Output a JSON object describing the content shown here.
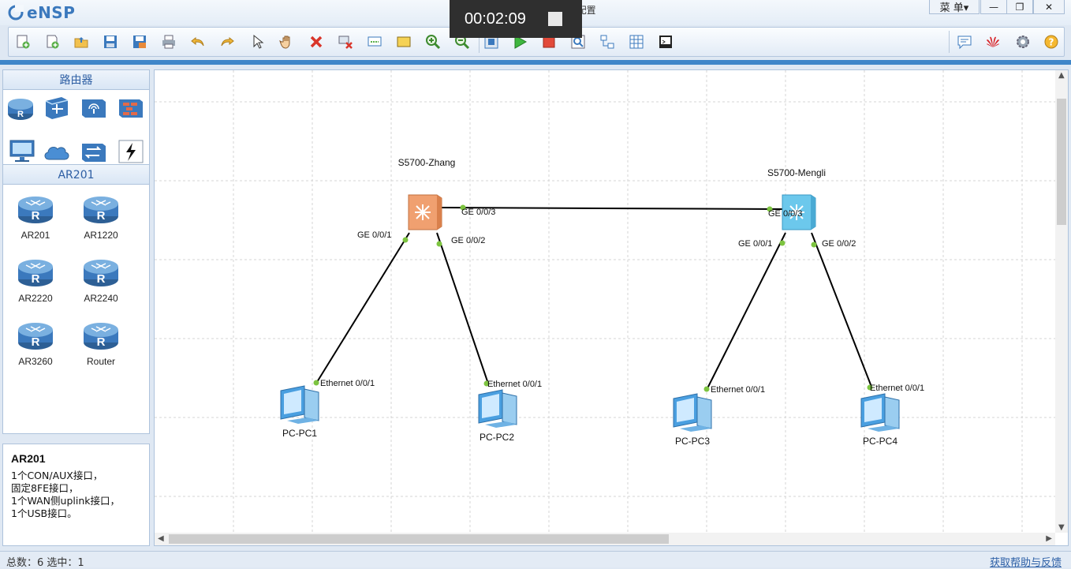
{
  "app": {
    "name": "eNSP",
    "window_title": "实验2交换机基本配置"
  },
  "window_controls": {
    "menu_label": "菜 单▾",
    "minimize": "—",
    "restore": "❐",
    "close": "✕"
  },
  "recording": {
    "time": "00:02:09"
  },
  "toolbar": {
    "left_icons": [
      "new-topology-icon",
      "new-template-icon",
      "open-icon",
      "save-icon",
      "save-as-icon",
      "print-icon",
      "undo-icon",
      "redo-icon",
      "select-icon",
      "pan-hand-icon",
      "delete-icon",
      "delete-link-icon",
      "text-icon",
      "rectangle-icon",
      "zoom-in-icon",
      "zoom-out-icon",
      "fit-icon",
      "start-device-icon",
      "stop-device-icon",
      "capture-icon",
      "topology-icon",
      "grid-icon",
      "console-icon"
    ],
    "right_icons": [
      "chat-icon",
      "huawei-icon",
      "settings-icon",
      "help-icon"
    ]
  },
  "left_panel": {
    "category_title": "路由器",
    "categories": [
      "router-category-icon",
      "switch-category-icon",
      "wlan-category-icon",
      "firewall-category-icon",
      "terminal-category-icon",
      "cloud-category-icon",
      "other-device-icon",
      "link-category-icon"
    ],
    "subcategory_title": "AR201",
    "devices": [
      {
        "label": "AR201"
      },
      {
        "label": "AR1220"
      },
      {
        "label": "AR2220"
      },
      {
        "label": "AR2240"
      },
      {
        "label": "AR3260"
      },
      {
        "label": "Router"
      }
    ],
    "info": {
      "title": "AR201",
      "lines": [
        "1个CON/AUX接口，",
        "固定8FE接口，",
        "1个WAN侧uplink接口，",
        "1个USB接口。"
      ]
    }
  },
  "topology": {
    "switches": [
      {
        "name": "S5700-Zhang",
        "color": "#f0a070"
      },
      {
        "name": "S5700-Mengli",
        "color": "#6cc8ec"
      }
    ],
    "pcs": [
      {
        "name": "PC-PC1"
      },
      {
        "name": "PC-PC2"
      },
      {
        "name": "PC-PC3"
      },
      {
        "name": "PC-PC4"
      }
    ],
    "port_labels": {
      "zhang_ge001": "GE 0/0/1",
      "zhang_ge002": "GE 0/0/2",
      "zhang_ge003": "GE 0/0/3",
      "mengli_ge003": "GE 0/0/3",
      "mengli_ge001": "GE 0/0/1",
      "mengli_ge002": "GE 0/0/2",
      "pc1_eth": "Ethernet 0/0/1",
      "pc2_eth": "Ethernet 0/0/1",
      "pc3_eth": "Ethernet 0/0/1",
      "pc4_eth": "Ethernet 0/0/1"
    },
    "link_color": "#000000",
    "port_dot_color": "#7dc440"
  },
  "status_bar": {
    "left": "总数：6 选中：1",
    "right": "获取帮助与反馈"
  }
}
